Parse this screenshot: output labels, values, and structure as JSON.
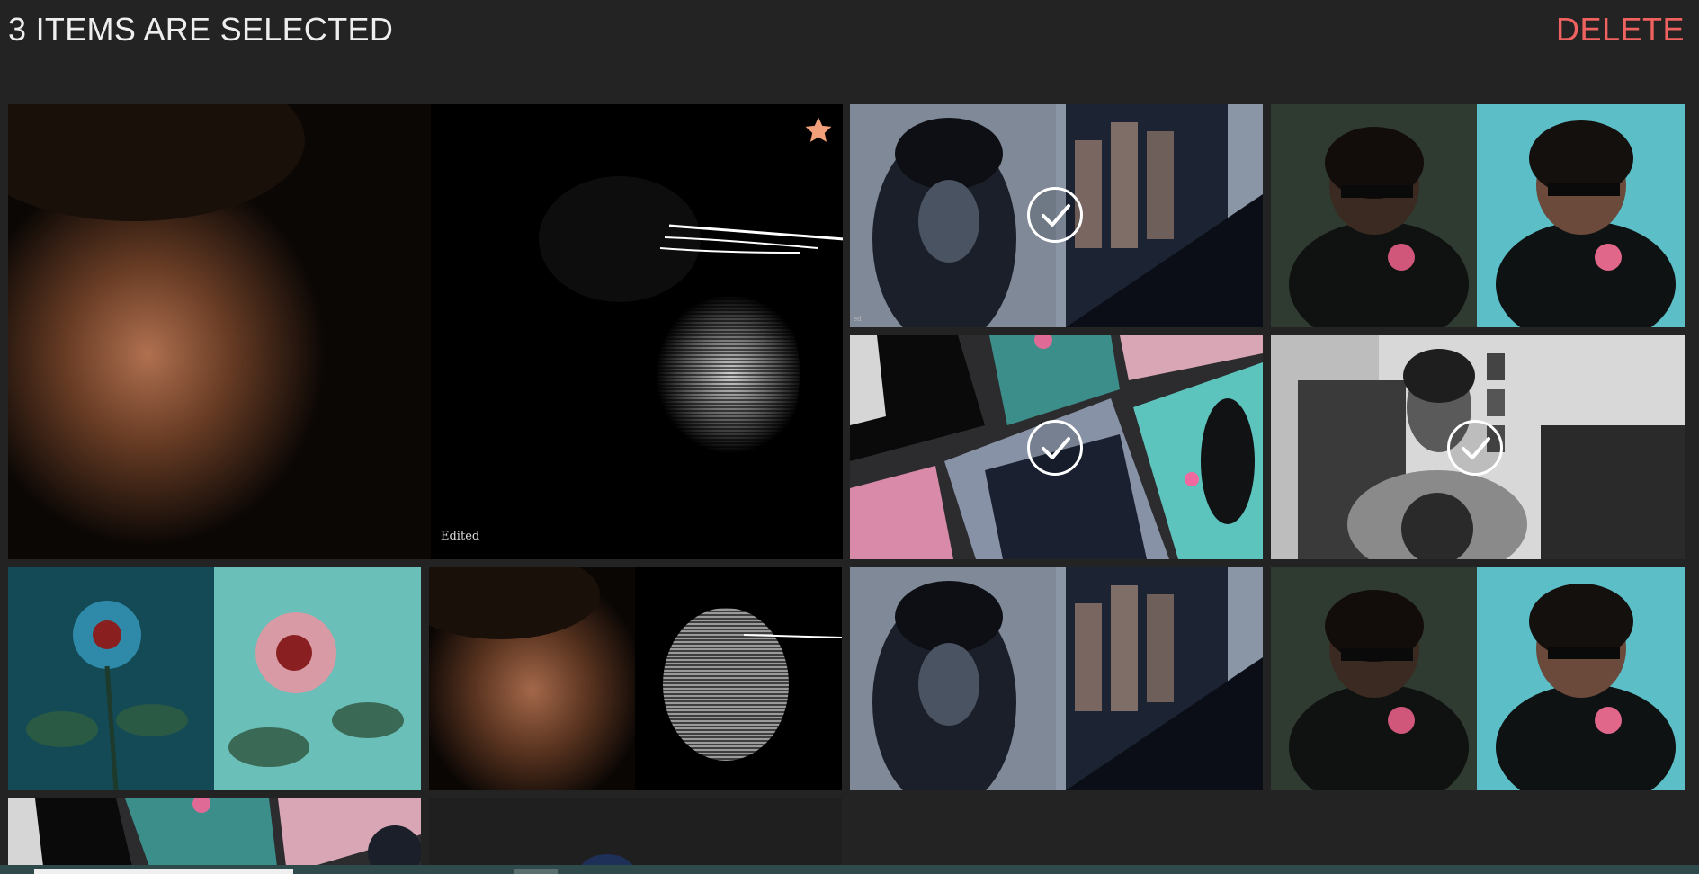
{
  "header": {
    "selection_status": "3 ITEMS ARE SELECTED",
    "delete_label": "DELETE"
  },
  "colors": {
    "delete": "#f0625f",
    "favorite_star": "#f2a07a",
    "featured_border": "#d9875a",
    "selected_border": "#e6e6e6"
  },
  "gallery": {
    "featured": {
      "caption": "Edited",
      "favorite": true,
      "icon": "star-icon"
    },
    "tiles": [
      {
        "subject": "curly-hair-portrait-glitch",
        "selected": true
      },
      {
        "subject": "sunglasses-rose-portrait",
        "selected": false
      },
      {
        "subject": "tilted-collage-pink-teal",
        "selected": true
      },
      {
        "subject": "bw-man-hand-on-chin",
        "selected": true
      },
      {
        "subject": "teal-rose-glitch",
        "selected": false
      },
      {
        "subject": "dark-portrait-scanlines",
        "selected": false
      },
      {
        "subject": "curly-hair-portrait-glitch",
        "selected": false
      },
      {
        "subject": "sunglasses-rose-portrait",
        "selected": false
      },
      {
        "subject": "tilted-collage-pink-teal",
        "selected": false
      },
      {
        "subject": "placeholder-dark",
        "selected": false
      }
    ],
    "selected_icon": "check-circle-icon"
  }
}
